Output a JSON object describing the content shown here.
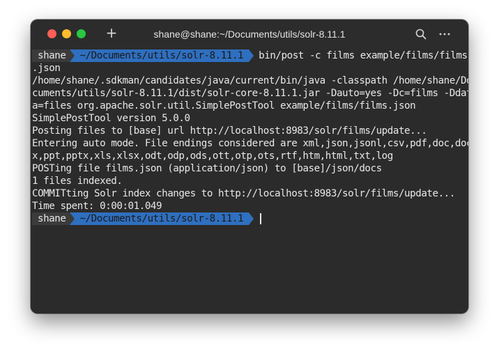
{
  "window": {
    "title": "shane@shane:~/Documents/utils/solr-8.11.1"
  },
  "colors": {
    "background": "#2b2b2b",
    "text": "#e8e8e8",
    "path_segment": "#2f6fbf",
    "close": "#ff5f57",
    "minimize": "#febc2e",
    "zoom": "#28c840"
  },
  "icons": {
    "new_tab": "plus-icon",
    "search": "search-icon",
    "more": "ellipsis-icon"
  },
  "prompt": {
    "user": "shane",
    "path": "~/Documents/utils/solr-8.11.1"
  },
  "command": "bin/post -c films example/films/films",
  "output": [
    ".json",
    "/home/shane/.sdkman/candidates/java/current/bin/java -classpath /home/shane/Do",
    "cuments/utils/solr-8.11.1/dist/solr-core-8.11.1.jar -Dauto=yes -Dc=films -Ddat",
    "a=files org.apache.solr.util.SimplePostTool example/films/films.json",
    "SimplePostTool version 5.0.0",
    "Posting files to [base] url http://localhost:8983/solr/films/update...",
    "Entering auto mode. File endings considered are xml,json,jsonl,csv,pdf,doc,doc",
    "x,ppt,pptx,xls,xlsx,odt,odp,ods,ott,otp,ots,rtf,htm,html,txt,log",
    "POSTing file films.json (application/json) to [base]/json/docs",
    "1 files indexed.",
    "COMMITting Solr index changes to http://localhost:8983/solr/films/update...",
    "Time spent: 0:00:01.049"
  ]
}
